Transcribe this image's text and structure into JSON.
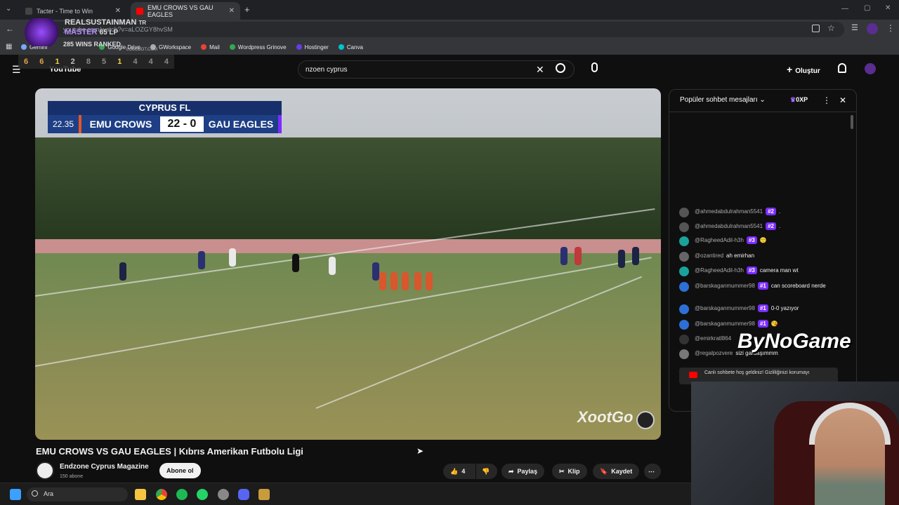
{
  "browser": {
    "tabs": [
      {
        "label": "Tacter - Time to Win",
        "active": false
      },
      {
        "label": "EMU CROWS VS GAU EAGLES",
        "active": true
      }
    ],
    "url": "youtube.com/watch?v=aLOZGY8hvSM",
    "bookmarks": [
      "Gemini",
      "Google Drive",
      "GWorkspace",
      "Mail",
      "Wordpress Grinove",
      "Hostinger",
      "Canva"
    ]
  },
  "overlay": {
    "player_name": "REALSUSTAINMAN",
    "region": "TR",
    "rank": "MASTER",
    "lp": "65 LP",
    "wins": "285 WINS RANKED",
    "site": "LOBOBOT.COM",
    "placements": [
      {
        "value": "6",
        "color": "#e8a14a"
      },
      {
        "value": "6",
        "color": "#e8a14a"
      },
      {
        "value": "1",
        "color": "#f0d04a"
      },
      {
        "value": "2",
        "color": "#c0c0c0"
      },
      {
        "value": "8",
        "color": "#8a8a8a"
      },
      {
        "value": "5",
        "color": "#8a8a8a"
      },
      {
        "value": "1",
        "color": "#f0d04a"
      },
      {
        "value": "4",
        "color": "#8a8a8a"
      },
      {
        "value": "4",
        "color": "#8a8a8a"
      },
      {
        "value": "4",
        "color": "#8a8a8a"
      }
    ]
  },
  "youtube": {
    "logo": "YouTube",
    "search_value": "nzoen cyprus",
    "create_label": "Oluştur"
  },
  "video": {
    "scoreboard": {
      "league": "CYPRUS FL",
      "clock": "22.35",
      "home": "EMU CROWS",
      "score": "22 - 0",
      "away": "GAU EAGLES"
    },
    "watermark": "XootGo",
    "title": "EMU CROWS VS GAU EAGLES | Kıbrıs Amerikan Futbolu Ligi",
    "channel": "Endzone Cyprus Magazine",
    "subscribers": "150 abone",
    "subscribe_label": "Abone ol",
    "likes": "4",
    "share_label": "Paylaş",
    "clip_label": "Klip",
    "save_label": "Kaydet"
  },
  "chat": {
    "header": "Popüler sohbet mesajları",
    "points": "0XP",
    "messages": [
      {
        "user": "@ahmedabdulrahman5541",
        "badge": "#2",
        "text": ".",
        "color": "#555"
      },
      {
        "user": "@ahmedabdulrahman5541",
        "badge": "#2",
        "text": ".",
        "color": "#555"
      },
      {
        "user": "@RagheedAdil-h3h",
        "badge": "#3",
        "text": "🙂",
        "color": "#1aa39a"
      },
      {
        "user": "@ozantired",
        "badge": "",
        "text": "ah emirhan",
        "color": "#666"
      },
      {
        "user": "@RagheedAdil-h3h",
        "badge": "#3",
        "text": "camera man wt",
        "color": "#1aa39a"
      },
      {
        "user": "@barskaganmummer98",
        "badge": "#1",
        "text": "can scoreboard nerde",
        "color": "#2d6fd6"
      },
      {
        "user": "@barskaganmummer98",
        "badge": "#1",
        "text": "0-0 yazıyor",
        "color": "#2d6fd6"
      },
      {
        "user": "@barskaganmummer98",
        "badge": "#1",
        "text": "😘",
        "color": "#2d6fd6"
      },
      {
        "user": "@emirkratl864",
        "badge": "",
        "text": "",
        "color": "#333"
      },
      {
        "user": "@regalpozvere",
        "badge": "",
        "text": "sizi gardaşımmm",
        "color": "#777"
      }
    ],
    "welcome": "Canlı sohbete hoş geldiniz! Gizliliğinizi korumayı"
  },
  "stream_brand": "ByNoGame",
  "taskbar": {
    "search_label": "Ara"
  }
}
